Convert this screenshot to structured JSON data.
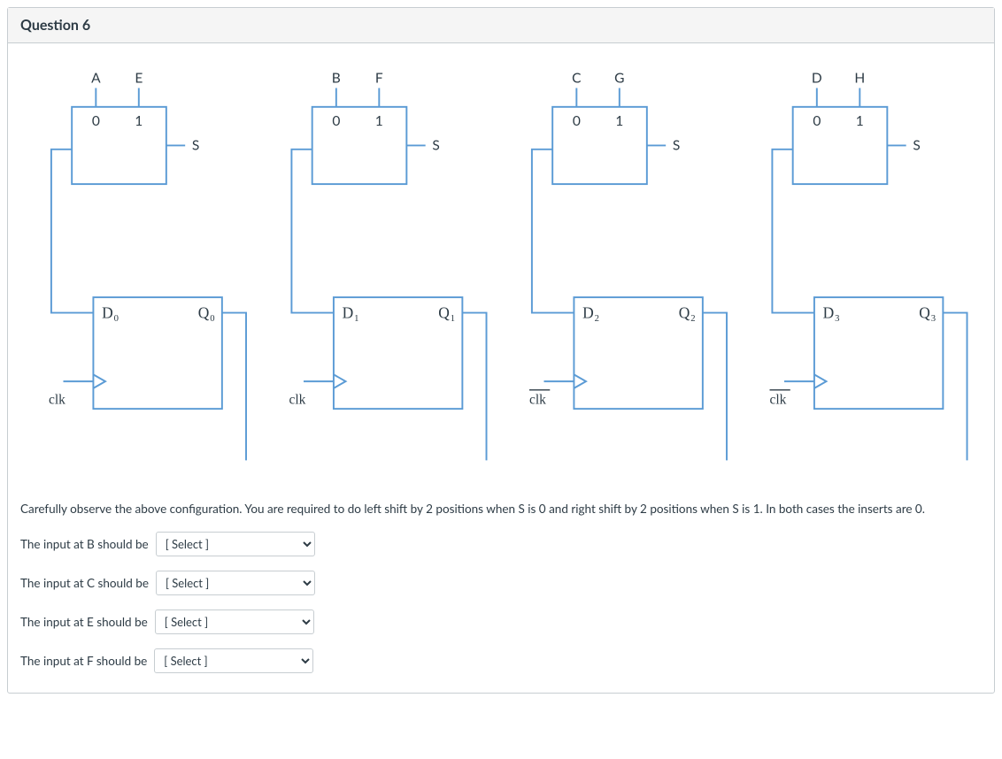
{
  "question_title": "Question 6",
  "instruction": "Carefully observe the above configuration. You are required to do left shift by 2 positions when S is 0 and right shift by 2 positions when S is 1. In both cases the inserts are 0.",
  "prompts": {
    "b": "The input at B should be",
    "c": "The input at C should be",
    "e": "The input at E should be",
    "f": "The input at F should be"
  },
  "select_placeholder": "[ Select ]",
  "mux": {
    "in0_label": "0",
    "in1_label": "1",
    "sel_label": "S"
  },
  "ff_clk": "clk",
  "stages": [
    {
      "topA": "A",
      "topB": "E",
      "d": "D",
      "dSub": "0",
      "q": "Q",
      "qSub": "0",
      "clkbar": false
    },
    {
      "topA": "B",
      "topB": "F",
      "d": "D",
      "dSub": "1",
      "q": "Q",
      "qSub": "1",
      "clkbar": false
    },
    {
      "topA": "C",
      "topB": "G",
      "d": "D",
      "dSub": "2",
      "q": "Q",
      "qSub": "2",
      "clkbar": true
    },
    {
      "topA": "D",
      "topB": "H",
      "d": "D",
      "dSub": "3",
      "q": "Q",
      "qSub": "3",
      "clkbar": true
    }
  ]
}
